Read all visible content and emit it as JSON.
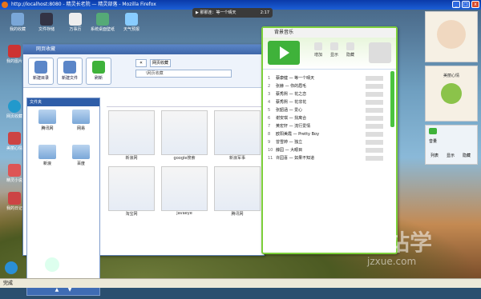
{
  "browser": {
    "title": "http://localhost:8080 - 精灵长老院 — 精灵部落 - Mozilla Firefox",
    "status": "完成"
  },
  "desktop_icons": [
    {
      "label": "我的收藏"
    },
    {
      "label": "文件存储"
    },
    {
      "label": "万事历"
    },
    {
      "label": "系统桌面壁纸"
    },
    {
      "label": "天气预报"
    },
    {
      "label": "我的图片"
    },
    {
      "label": "网页收藏"
    },
    {
      "label": "美丽心情"
    },
    {
      "label": "我的日记"
    },
    {
      "label": "精灵小说"
    }
  ],
  "mini_player": {
    "track": "那那连：等一个晴天",
    "time": "2:17"
  },
  "collection_window": {
    "title": "网页收藏",
    "toolbar": [
      {
        "label": "新建目录"
      },
      {
        "label": "新建文件"
      },
      {
        "label": "刷新"
      }
    ],
    "address_label": "网页收藏",
    "address_value": "\\网页收藏",
    "panel_title": "文件夹",
    "folders": [
      {
        "label": "腾讯网"
      },
      {
        "label": "网易"
      },
      {
        "label": "新浪"
      },
      {
        "label": "百度"
      }
    ],
    "thumbs": [
      {
        "label": "新浪网"
      },
      {
        "label": "google搜索"
      },
      {
        "label": "新浪军事"
      },
      {
        "label": "淘宝网"
      },
      {
        "label": "javaeye"
      },
      {
        "label": "腾讯网"
      }
    ]
  },
  "music_window": {
    "title": "背景音乐",
    "controls": [
      {
        "label": "增加"
      },
      {
        "label": "显示"
      },
      {
        "label": "隐藏"
      }
    ],
    "songs": [
      {
        "n": "1",
        "title": "蔡康健 — 等一个晴天"
      },
      {
        "n": "2",
        "title": "张赫 — 你的眉毛"
      },
      {
        "n": "3",
        "title": "蔡秀熙 — 花之恋"
      },
      {
        "n": "4",
        "title": "蔡秀熙 — 花非花"
      },
      {
        "n": "5",
        "title": "张韶涵 — 爱心"
      },
      {
        "n": "6",
        "title": "谢安琪 — 找离合"
      },
      {
        "n": "7",
        "title": "黄宏轩 — 流行爱情"
      },
      {
        "n": "8",
        "title": "欧阳美霞 — Pretty Boy"
      },
      {
        "n": "9",
        "title": "曾雪婷 — 独立"
      },
      {
        "n": "10",
        "title": "薛园 — 大眼目"
      },
      {
        "n": "11",
        "title": "许园喜 — 如果不知道"
      }
    ]
  },
  "side": {
    "mood": "美丽心情",
    "volume": "音量",
    "btns": [
      {
        "label": "列表"
      },
      {
        "label": "显示"
      },
      {
        "label": "隐藏"
      }
    ]
  },
  "watermark": {
    "text": "建站学",
    "sub": "jzxue.com"
  },
  "colors": {
    "accent": "#3fb23a",
    "title": "#1b5fd6"
  }
}
